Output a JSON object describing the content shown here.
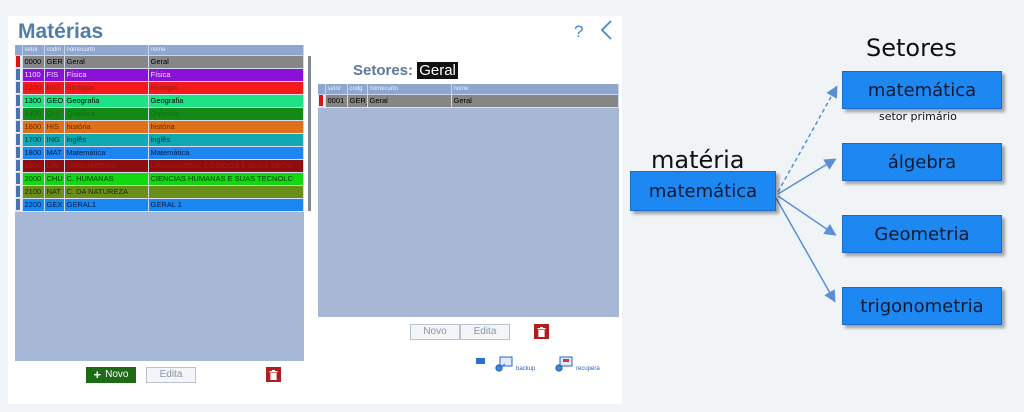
{
  "app": {
    "title": "Matérias",
    "help_icon": "?",
    "back_icon": "chevron-left-icon"
  },
  "materias": {
    "columns": [
      "setor",
      "codm",
      "nomecurto",
      "nome"
    ],
    "rows": [
      {
        "setor": "0000",
        "codm": "GER",
        "nomecurto": "Geral",
        "nome": "Geral",
        "bg": "#868686",
        "fg": "#000000",
        "selected": true
      },
      {
        "setor": "1100",
        "codm": "FIS",
        "nomecurto": "Física",
        "nome": "Física",
        "bg": "#8b11d8",
        "fg": "#f0e0ff"
      },
      {
        "setor": "1200",
        "codm": "BIO",
        "nomecurto": "Biologia",
        "nome": "Biologia",
        "bg": "#f31a1a",
        "fg": "#9a1a1a"
      },
      {
        "setor": "1300",
        "codm": "GEO",
        "nomecurto": "Geografia",
        "nome": "Geografia",
        "bg": "#1ee384",
        "fg": "#000000"
      },
      {
        "setor": "1400",
        "codm": "QUI",
        "nomecurto": "Química",
        "nome": "Química",
        "bg": "#138a18",
        "fg": "#2a5a2a"
      },
      {
        "setor": "1600",
        "codm": "HIS",
        "nomecurto": "história",
        "nome": "história",
        "bg": "#e0711a",
        "fg": "#5a2a00"
      },
      {
        "setor": "1700",
        "codm": "ING",
        "nomecurto": "inglês",
        "nome": "inglês",
        "bg": "#0fa8b3",
        "fg": "#003333"
      },
      {
        "setor": "1800",
        "codm": "MAT",
        "nomecurto": "Matemática",
        "nome": "Matemática",
        "bg": "#1e86f2",
        "fg": "#001a40"
      },
      {
        "setor": "1900",
        "codm": "LIN",
        "nomecurto": "LINGUAGENS",
        "nome": "LINGUAGENS, CÓDIGOS E SUAS TECN",
        "bg": "#8c0e0e",
        "fg": "#b01616"
      },
      {
        "setor": "2000",
        "codm": "CHU",
        "nomecurto": "C. HUMANAS",
        "nome": "CIENCIAS HUMANAS E SUAS TECNOLC",
        "bg": "#11d811",
        "fg": "#003300"
      },
      {
        "setor": "2100",
        "codm": "NAT",
        "nomecurto": "C. DA NATUREZA",
        "nome": "",
        "bg": "#6a8e1a",
        "fg": "#1a2a00"
      },
      {
        "setor": "2200",
        "codm": "GEX",
        "nomecurto": "GERAL1",
        "nome": "GERAL 1",
        "bg": "#1a86f2",
        "fg": "#001a40"
      }
    ],
    "buttons": {
      "novo": "Novo",
      "edita": "Edita"
    }
  },
  "setores": {
    "label": "Setores:",
    "value": "Geral",
    "columns": [
      "setor",
      "codg",
      "nomecurto",
      "nome"
    ],
    "rows": [
      {
        "setor": "0001",
        "codg": "GER_",
        "nomecurto": "Geral",
        "nome": "Geral",
        "bg": "#868686",
        "fg": "#000000",
        "selected": true
      }
    ],
    "buttons": {
      "novo": "Novo",
      "edita": "Edita"
    }
  },
  "footer": {
    "backup": "backup",
    "recupera": "recupera"
  },
  "diagram": {
    "heading_setores": "Setores",
    "heading_materia": "matéria",
    "source_box": "matemática",
    "targets": [
      "matemática",
      "álgebra",
      "Geometria",
      "trigonometria"
    ],
    "primary_caption": "setor primário",
    "box_color": "#1e88f2"
  }
}
